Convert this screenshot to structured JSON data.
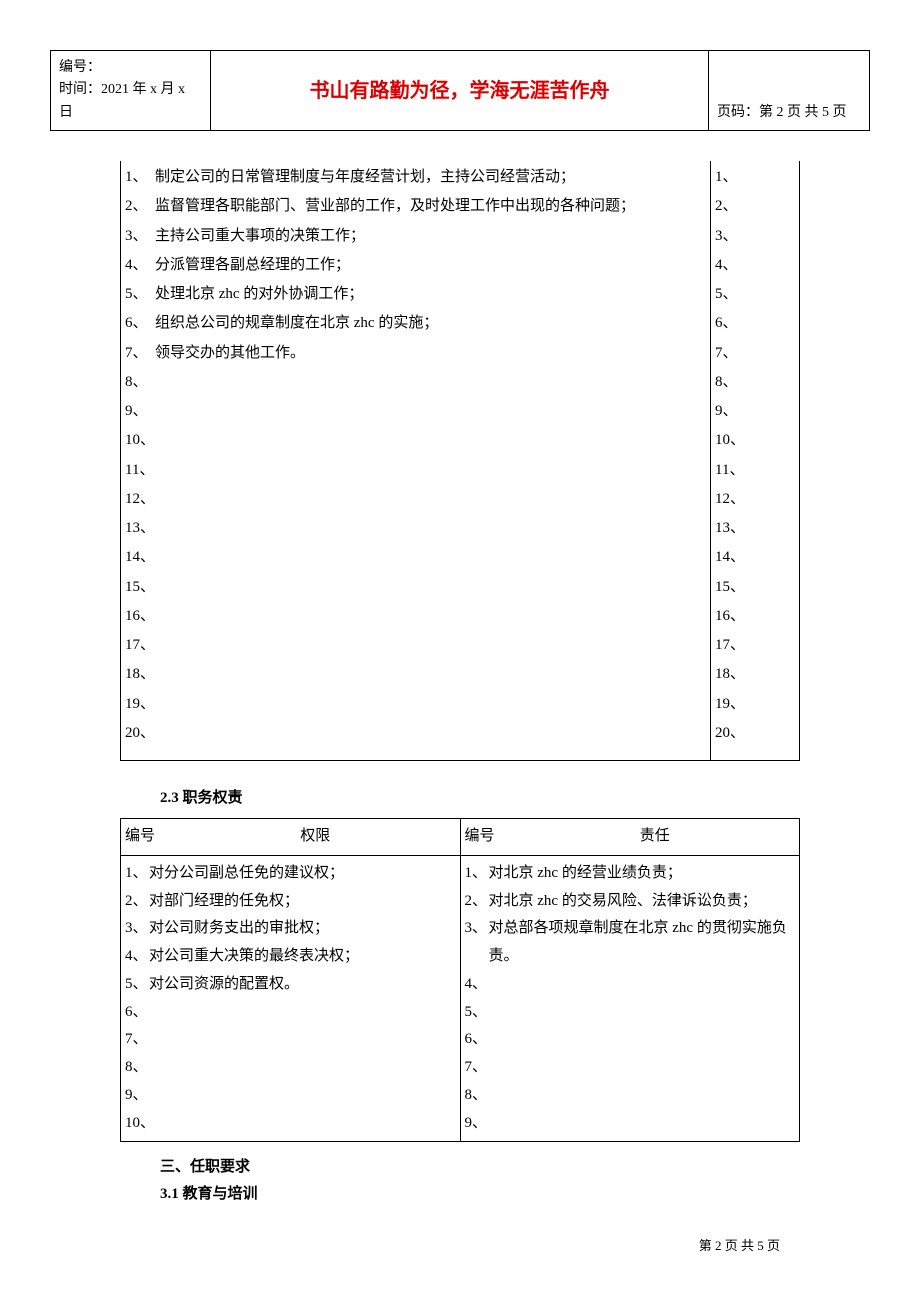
{
  "header": {
    "label_bianhao": "编号：",
    "label_time": "时间：2021 年 x 月 x 日",
    "motto": "书山有路勤为径，学海无涯苦作舟",
    "page_code": "页码：第 2 页  共 5 页"
  },
  "table1": {
    "left": [
      {
        "num": "1、",
        "text": "制定公司的日常管理制度与年度经营计划，主持公司经营活动；"
      },
      {
        "num": "2、",
        "text": "监督管理各职能部门、营业部的工作，及时处理工作中出现的各种问题；"
      },
      {
        "num": "3、",
        "text": "主持公司重大事项的决策工作；"
      },
      {
        "num": "4、",
        "text": "分派管理各副总经理的工作；"
      },
      {
        "num": "5、",
        "text": "处理北京 zhc 的对外协调工作；"
      },
      {
        "num": "6、",
        "text": "组织总公司的规章制度在北京 zhc 的实施；"
      },
      {
        "num": "7、",
        "text": "领导交办的其他工作。"
      },
      {
        "num": "8、",
        "text": ""
      },
      {
        "num": "9、",
        "text": ""
      },
      {
        "num": "10、",
        "text": ""
      },
      {
        "num": "11、",
        "text": ""
      },
      {
        "num": "12、",
        "text": ""
      },
      {
        "num": "13、",
        "text": ""
      },
      {
        "num": "14、",
        "text": ""
      },
      {
        "num": "15、",
        "text": ""
      },
      {
        "num": "16、",
        "text": ""
      },
      {
        "num": "17、",
        "text": ""
      },
      {
        "num": "18、",
        "text": ""
      },
      {
        "num": "19、",
        "text": ""
      },
      {
        "num": "20、",
        "text": ""
      }
    ],
    "right": [
      "1、",
      "2、",
      "3、",
      "4、",
      "5、",
      "6、",
      "7、",
      "8、",
      "9、",
      "10、",
      "11、",
      "12、",
      "13、",
      "14、",
      "15、",
      "16、",
      "17、",
      "18、",
      "19、",
      "20、"
    ]
  },
  "section2_3": {
    "heading": "2.3  职务权责",
    "hdr_bianhao": "编号",
    "hdr_quanxian": "权限",
    "hdr_zeren": "责任",
    "left": [
      {
        "num": "1、",
        "text": "对分公司副总任免的建议权；"
      },
      {
        "num": "2、",
        "text": "对部门经理的任免权；"
      },
      {
        "num": "3、",
        "text": "对公司财务支出的审批权；"
      },
      {
        "num": "4、",
        "text": "对公司重大决策的最终表决权；"
      },
      {
        "num": "5、",
        "text": "对公司资源的配置权。"
      },
      {
        "num": "6、",
        "text": ""
      },
      {
        "num": "7、",
        "text": ""
      },
      {
        "num": "8、",
        "text": ""
      },
      {
        "num": "9、",
        "text": ""
      },
      {
        "num": "10、",
        "text": ""
      }
    ],
    "right": [
      {
        "num": "1、",
        "text": "对北京 zhc 的经营业绩负责；"
      },
      {
        "num": "2、",
        "text": "对北京 zhc 的交易风险、法律诉讼负责；"
      },
      {
        "num": "3、",
        "text": "对总部各项规章制度在北京 zhc 的贯彻实施负责。"
      },
      {
        "num": "4、",
        "text": ""
      },
      {
        "num": "5、",
        "text": ""
      },
      {
        "num": "6、",
        "text": ""
      },
      {
        "num": "7、",
        "text": ""
      },
      {
        "num": "8、",
        "text": ""
      },
      {
        "num": "9、",
        "text": ""
      }
    ]
  },
  "section3": {
    "title": "三、任职要求",
    "sub31": "3.1  教育与培训"
  },
  "footer": "第  2  页  共  5  页"
}
